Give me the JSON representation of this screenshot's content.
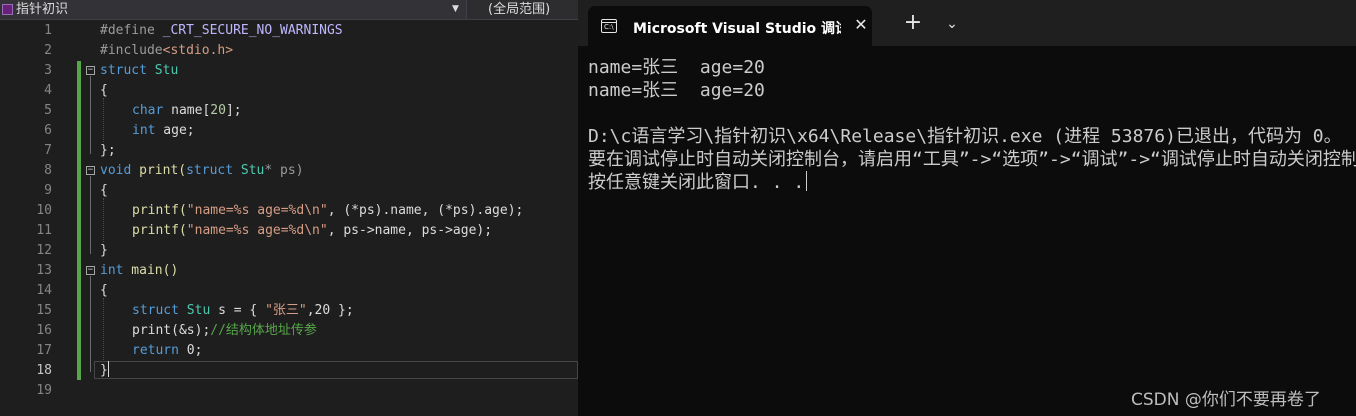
{
  "editor": {
    "scope_dropdown": "指针初识",
    "scope_right": "(全局范围)",
    "line_numbers": [
      "1",
      "2",
      "3",
      "4",
      "5",
      "6",
      "7",
      "8",
      "9",
      "10",
      "11",
      "12",
      "13",
      "14",
      "15",
      "16",
      "17",
      "18",
      "19"
    ],
    "code": {
      "l1": {
        "a": "#define ",
        "b": "_CRT_SECURE_NO_WARNINGS"
      },
      "l2": {
        "a": "#include",
        "b": "<stdio.h>"
      },
      "l3": {
        "a": "struct",
        "b": " Stu"
      },
      "l4": "{",
      "l5": {
        "a": "char",
        "b": " name[",
        "c": "20",
        "d": "];"
      },
      "l6": {
        "a": "int",
        "b": " age;"
      },
      "l7": "};",
      "l8": {
        "a": "void",
        "b": " print(",
        "c": "struct",
        "d": " Stu",
        "e": "* ps)"
      },
      "l9": "{",
      "l10": {
        "a": "printf(",
        "b": "\"name=%s age=%d\\n\"",
        "c": ", (*ps).name, (*ps).age);"
      },
      "l11": {
        "a": "printf(",
        "b": "\"name=%s age=%d\\n\"",
        "c": ", ps->name, ps->age);"
      },
      "l12": "}",
      "l13": {
        "a": "int",
        "b": " main()"
      },
      "l14": "{",
      "l15": {
        "a": "struct",
        "b": " Stu",
        "c": " s = { ",
        "d": "\"张三\"",
        "e": ",20 };"
      },
      "l16": {
        "a": "print(&s);",
        "b": "//结构体地址传参"
      },
      "l17": {
        "a": "return",
        "b": " 0;"
      },
      "l18": "}"
    }
  },
  "terminal": {
    "tab_title": "Microsoft Visual Studio 调试控制台",
    "tab_icon_glyph": "C:\\",
    "close_glyph": "✕",
    "new_tab_glyph": "+",
    "dropdown_glyph": "⌄",
    "lines": [
      "name=张三  age=20",
      "name=张三  age=20",
      "",
      "D:\\c语言学习\\指针初识\\x64\\Release\\指针初识.exe (进程 53876)已退出，代码为 0。",
      "要在调试停止时自动关闭控制台，请启用“工具”->“选项”->“调试”->“调试停止时自动关闭控制台”。",
      "按任意键关闭此窗口. . ."
    ]
  },
  "watermark": "CSDN @你们不要再卷了"
}
